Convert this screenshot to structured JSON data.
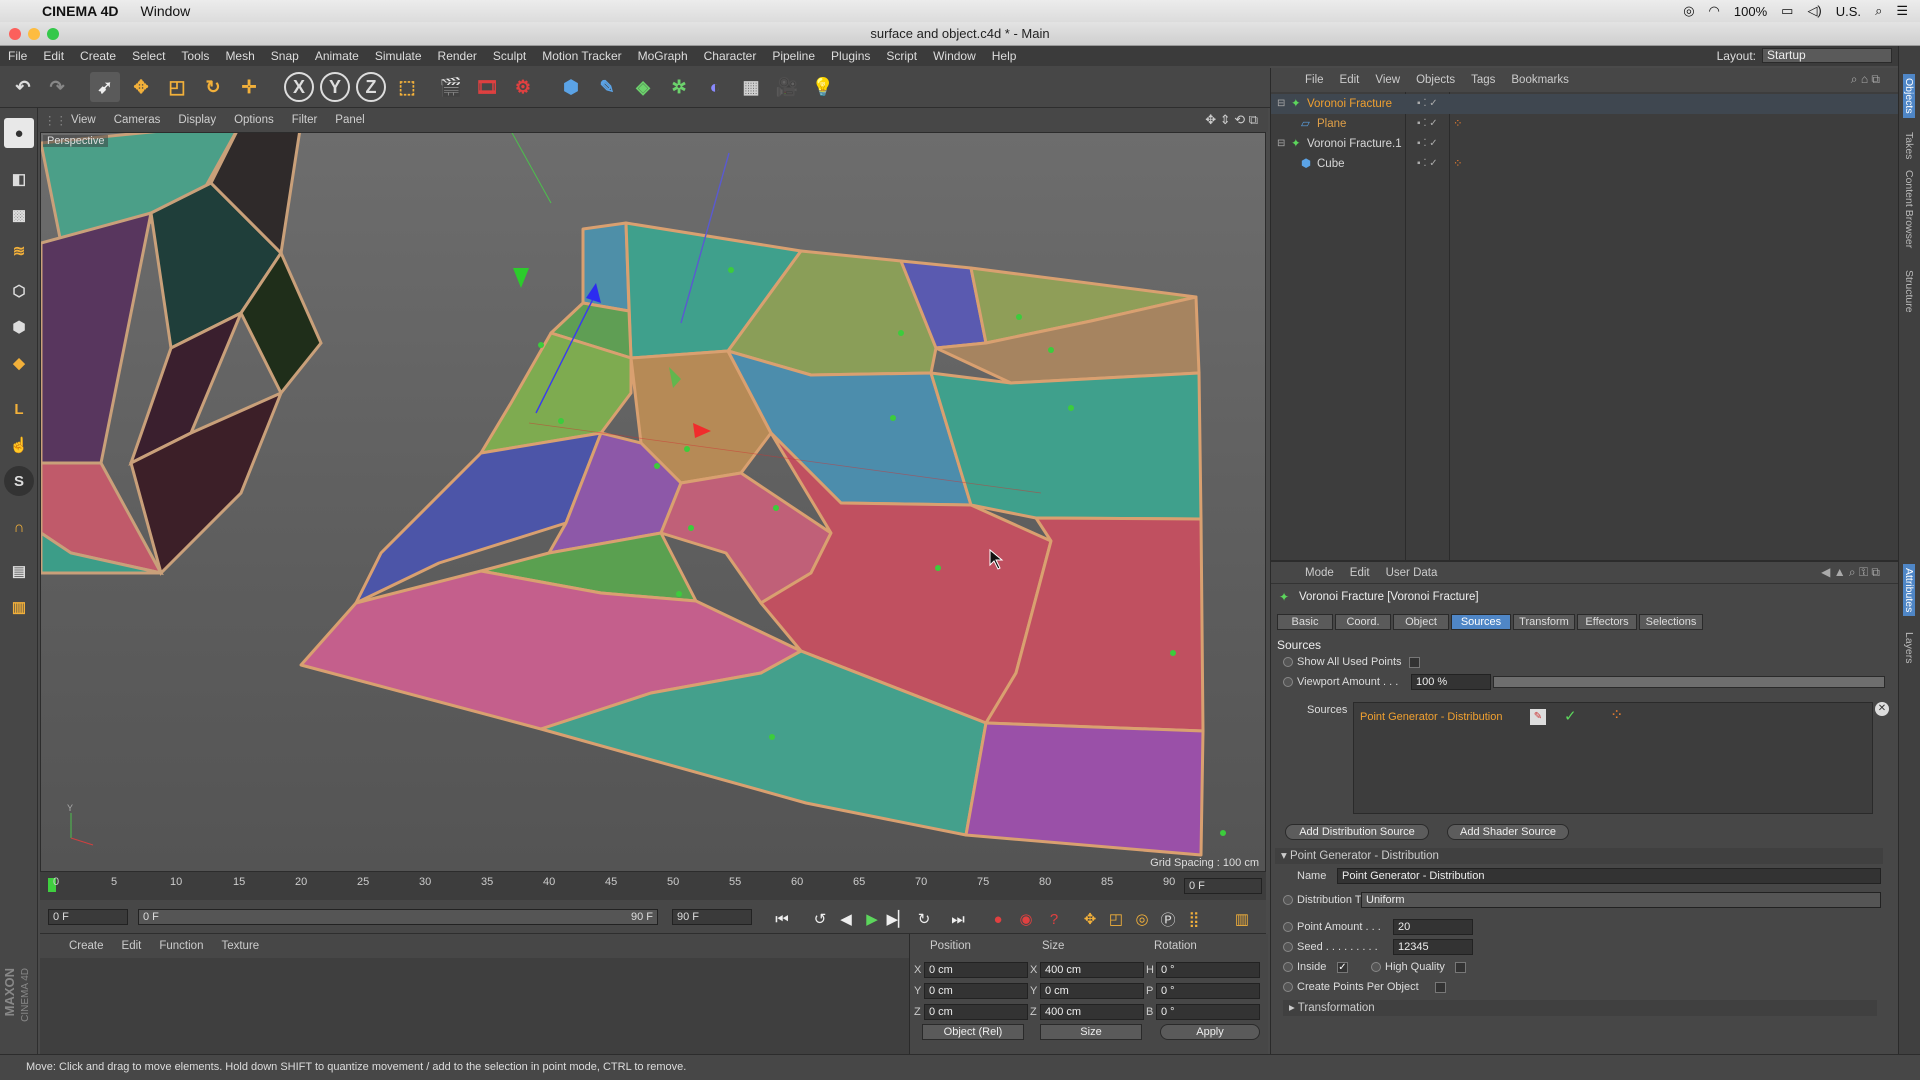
{
  "mac_menu": {
    "app": "CINEMA 4D",
    "items": [
      "Window"
    ],
    "battery": "100%",
    "keyboard": "U.S."
  },
  "window": {
    "title": "surface and object.c4d * - Main"
  },
  "main_menu": [
    "File",
    "Edit",
    "Create",
    "Select",
    "Tools",
    "Mesh",
    "Snap",
    "Animate",
    "Simulate",
    "Render",
    "Sculpt",
    "Motion Tracker",
    "MoGraph",
    "Character",
    "Pipeline",
    "Plugins",
    "Script",
    "Window",
    "Help"
  ],
  "layout": {
    "label": "Layout:",
    "value": "Startup"
  },
  "toolbar": {
    "axis_x": "X",
    "axis_y": "Y",
    "axis_z": "Z"
  },
  "viewport": {
    "menu": [
      "View",
      "Cameras",
      "Display",
      "Options",
      "Filter",
      "Panel"
    ],
    "label": "Perspective",
    "grid_spacing": "Grid Spacing : 100 cm"
  },
  "timeline": {
    "ticks": [
      "0",
      "5",
      "10",
      "15",
      "20",
      "25",
      "30",
      "35",
      "40",
      "45",
      "50",
      "55",
      "60",
      "65",
      "70",
      "75",
      "80",
      "85",
      "90"
    ],
    "current_frame": "0 F",
    "start_frame": "0 F",
    "range_start": "0 F",
    "range_end": "90 F",
    "end_frame": "90 F"
  },
  "material_manager": {
    "menu": [
      "Create",
      "Edit",
      "Function",
      "Texture"
    ]
  },
  "coordinates": {
    "headers": {
      "position": "Position",
      "size": "Size",
      "rotation": "Rotation"
    },
    "rows": [
      {
        "axis": "X",
        "pos": "0 cm",
        "size_axis": "X",
        "size": "400 cm",
        "rot_axis": "H",
        "rot": "0 °"
      },
      {
        "axis": "Y",
        "pos": "0 cm",
        "size_axis": "Y",
        "size": "0 cm",
        "rot_axis": "P",
        "rot": "0 °"
      },
      {
        "axis": "Z",
        "pos": "0 cm",
        "size_axis": "Z",
        "size": "400 cm",
        "rot_axis": "B",
        "rot": "0 °"
      }
    ],
    "mode": "Object (Rel)",
    "size_mode": "Size",
    "apply": "Apply"
  },
  "status": "Move: Click and drag to move elements. Hold down SHIFT to quantize movement / add to the selection in point mode, CTRL to remove.",
  "object_manager": {
    "menu": [
      "File",
      "Edit",
      "View",
      "Objects",
      "Tags",
      "Bookmarks"
    ],
    "objects": [
      {
        "name": "Voronoi Fracture",
        "color": "#f0a030"
      },
      {
        "name": "Plane",
        "color": "#e0a048"
      },
      {
        "name": "Voronoi Fracture.1",
        "color": "#d8d8d8"
      },
      {
        "name": "Cube",
        "color": "#d8d8d8"
      }
    ]
  },
  "attributes": {
    "menu": [
      "Mode",
      "Edit",
      "User Data"
    ],
    "title": "Voronoi Fracture [Voronoi Fracture]",
    "tabs": [
      "Basic",
      "Coord.",
      "Object",
      "Sources",
      "Transform",
      "Effectors",
      "Selections"
    ],
    "active_tab": "Sources",
    "section": "Sources",
    "show_all_used_points": "Show All Used Points",
    "viewport_amount_label": "Viewport Amount . . .",
    "viewport_amount": "100 %",
    "sources_label": "Sources",
    "source_item": "Point Generator - Distribution",
    "add_distribution": "Add Distribution Source",
    "add_shader": "Add Shader Source",
    "group": "Point Generator - Distribution",
    "name_label": "Name",
    "name_value": "Point Generator - Distribution",
    "distribution_type_label": "Distribution Type",
    "distribution_type": "Uniform",
    "point_amount_label": "Point Amount . . .",
    "point_amount": "20",
    "seed_label": "Seed . . . . . . . . .",
    "seed": "12345",
    "inside_label": "Inside",
    "high_quality_label": "High Quality",
    "create_points_label": "Create Points Per Object",
    "transformation": "Transformation"
  },
  "right_tabs": [
    "Objects",
    "Takes",
    "Content Browser",
    "Structure",
    "Attributes",
    "Layers"
  ],
  "branding": {
    "maxon": "MAXON",
    "c4d": "CINEMA 4D"
  },
  "colors": {
    "accent": "#4f86c6",
    "selected_object": "#f0a030"
  }
}
